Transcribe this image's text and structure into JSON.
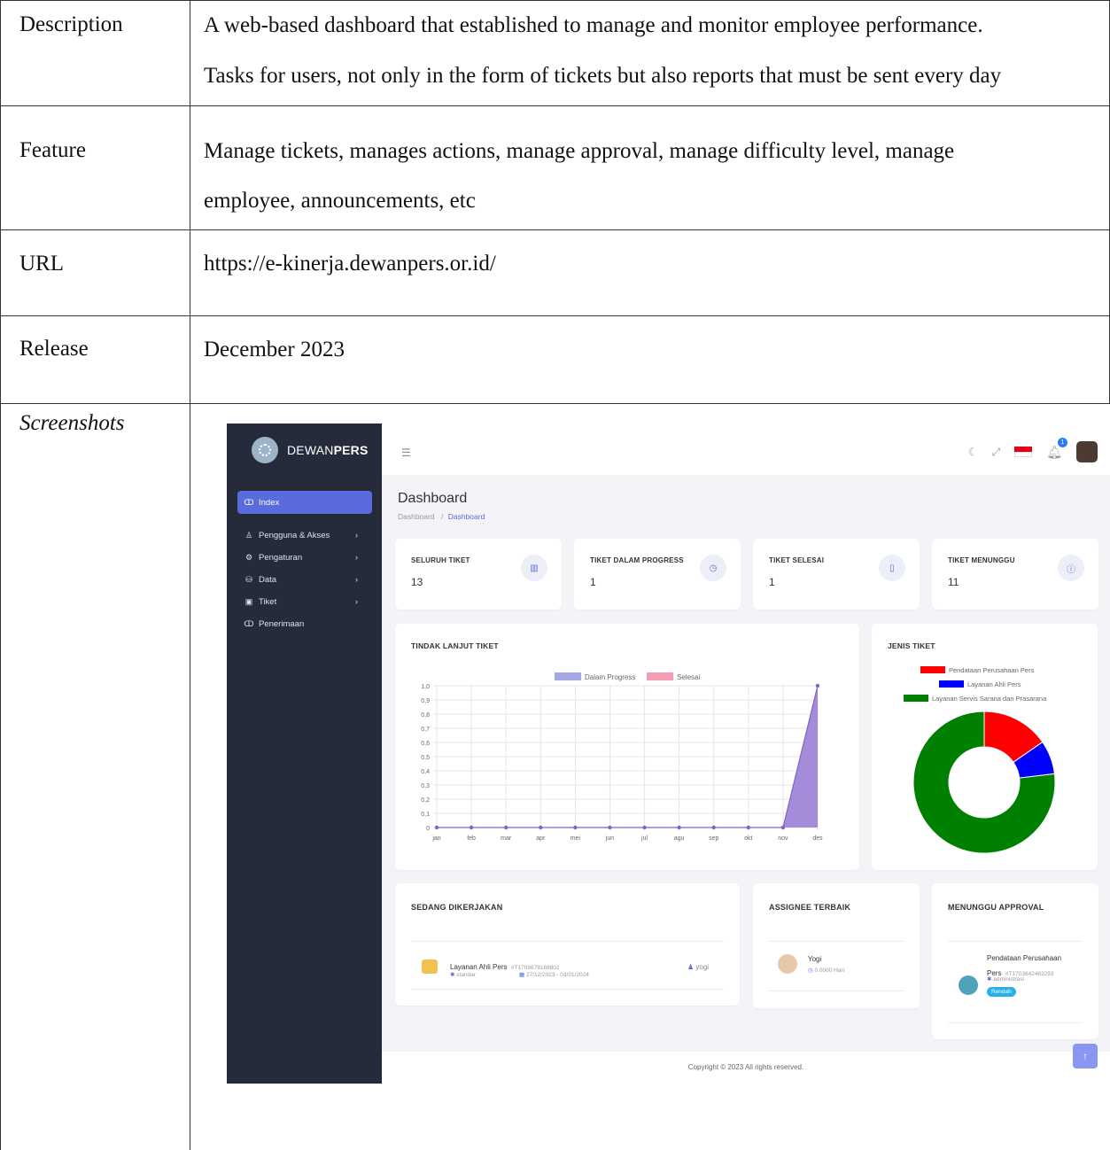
{
  "table": {
    "rows": [
      {
        "label": "Description",
        "lines": [
          "A web-based dashboard that established to manage and monitor employee performance.",
          "Tasks for users, not only in the form of tickets but also reports that must be sent every day"
        ]
      },
      {
        "label": "Feature",
        "lines": [
          "Manage tickets, manages actions, manage approval, manage difficulty level, manage",
          "employee, announcements, etc"
        ]
      },
      {
        "label": "URL",
        "lines": [
          "https://e-kinerja.dewanpers.or.id/"
        ]
      },
      {
        "label": "Release",
        "lines": [
          "December 2023"
        ]
      },
      {
        "label": "Screenshots",
        "lines": []
      }
    ]
  },
  "app": {
    "brand_prefix": "DEWAN",
    "brand_suffix": "PERS",
    "sidebar": [
      {
        "label": "Index",
        "icon": "gauge-icon",
        "glyph": "ↀ"
      },
      {
        "label": "Pengguna & Akses",
        "icon": "user-icon",
        "glyph": "♙"
      },
      {
        "label": "Pengaturan",
        "icon": "gear-icon",
        "glyph": "⚙"
      },
      {
        "label": "Data",
        "icon": "database-icon",
        "glyph": "⛁"
      },
      {
        "label": "Tiket",
        "icon": "ticket-icon",
        "glyph": "▣"
      },
      {
        "label": "Penerimaan",
        "icon": "gauge-icon",
        "glyph": "ↀ"
      }
    ],
    "chevron": "›",
    "notification_count": "1",
    "page_title": "Dashboard",
    "breadcrumb_root": "Dashboard",
    "breadcrumb_sep": "/",
    "breadcrumb_current": "Dashboard",
    "stats": [
      {
        "label": "SELURUH TIKET",
        "value": "13",
        "icon": "bar-chart-icon"
      },
      {
        "label": "TIKET DALAM PROGRESS",
        "value": "1",
        "icon": "clock-icon"
      },
      {
        "label": "TIKET SELESAI",
        "value": "1",
        "icon": "book-icon"
      },
      {
        "label": "TIKET MENUNGGU",
        "value": "11",
        "icon": "info-icon"
      }
    ],
    "line_card_title": "TINDAK LANJUT TIKET",
    "pie_card_title": "JENIS TIKET",
    "working_title": "SEDANG DIKERJAKAN",
    "working_item": {
      "name": "Layanan Ahli Pers",
      "code": "#T1703679168802",
      "level": "standar",
      "dates": "27/12/2023 - 03/01/2024",
      "user": "yogi"
    },
    "assignee_title": "ASSIGNEE TERBAIK",
    "assignee": {
      "name": "Yogi",
      "time": "0.0000 Hari"
    },
    "approval_title": "MENUNGGU APPROVAL",
    "approval_item": {
      "name": "Pendataan Perusahaan",
      "name2": "Pers",
      "code": "#T1703642463293",
      "role": "administrasi",
      "badge": "Rendah"
    },
    "footer": "Copyright © 2023 All rights reserved.",
    "colors": {
      "sidebar": "#262b3b",
      "accent": "#5a6bde",
      "progress": "#9b8bd9",
      "selesai": "#f49cb4"
    }
  },
  "chart_data": [
    {
      "type": "area",
      "title": "TINDAK LANJUT TIKET",
      "categories": [
        "jan",
        "feb",
        "mar",
        "apr",
        "mei",
        "jun",
        "jul",
        "agu",
        "sep",
        "okt",
        "nov",
        "des"
      ],
      "series": [
        {
          "name": "Dalam Progress",
          "values": [
            0,
            0,
            0,
            0,
            0,
            0,
            0,
            0,
            0,
            0,
            0,
            1
          ],
          "color": "#a3a9e0"
        },
        {
          "name": "Selesai",
          "values": [
            0,
            0,
            0,
            0,
            0,
            0,
            0,
            0,
            0,
            0,
            0,
            0
          ],
          "color": "#f49cb4"
        }
      ],
      "yticks": [
        "1,0",
        "0,9",
        "0,8",
        "0,7",
        "0,6",
        "0,5",
        "0,4",
        "0,3",
        "0,2",
        "0,1",
        "0"
      ],
      "ylim": [
        0,
        1
      ],
      "grid": true,
      "legend": "top"
    },
    {
      "type": "pie",
      "title": "JENIS TIKET",
      "labels": [
        "Pendataan Perusahaan Pers",
        "Layanan Ahli Pers",
        "Layanan Servis Sarana dan Prasarana"
      ],
      "values": [
        2,
        1,
        10
      ],
      "colors": [
        "#ff0000",
        "#0000ff",
        "#008000"
      ],
      "legend": "top"
    }
  ]
}
